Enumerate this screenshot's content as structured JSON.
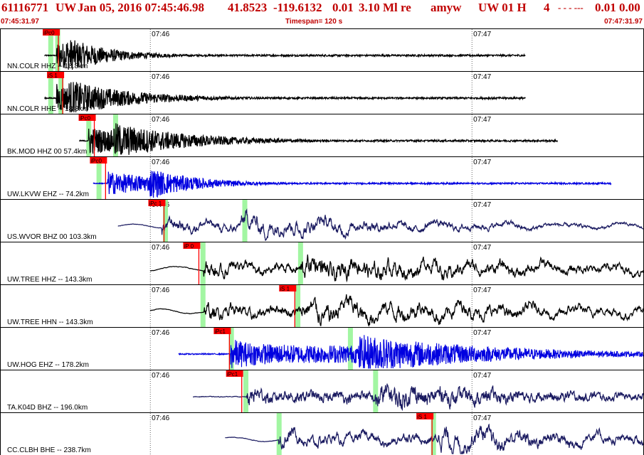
{
  "header": {
    "event_id": "61116771",
    "network": "UW",
    "datetime": "Jan 05, 2016 07:45:46.98",
    "latitude": "41.8523",
    "longitude": "-119.6132",
    "depth": "0.01",
    "magnitude": "3.10 Ml re",
    "author": "amyw",
    "source": "UW 01 H",
    "count": "4",
    "flags": "-  -  - ---",
    "extra": "0.01 0.00"
  },
  "timebar": {
    "start": "07:45:31.97",
    "timespan": "Timespan= 120 s",
    "end": "07:47:31.97"
  },
  "chart_data": {
    "type": "line",
    "title": "",
    "time_start_s": 0,
    "time_end_s": 120,
    "time_ticks": [
      {
        "label": "07:46",
        "t": 28.03
      },
      {
        "label": "07:47",
        "t": 88.03
      }
    ],
    "traces": [
      {
        "label": "NN.COLR HHZ -- 18.8km",
        "color": "#000000",
        "amp": "high",
        "data_start": 8.3,
        "data_end": 98.0,
        "onset": 10.5,
        "s_arrival": 12.4,
        "coda_decay": 8,
        "period": "short",
        "picks": [
          {
            "label": "iPc0",
            "t": 9.3,
            "color": "#ff0000"
          }
        ],
        "green_marks": [
          9.4,
          10.7
        ]
      },
      {
        "label": "NN.COLR HHE -- 18.8km",
        "color": "#000000",
        "amp": "high",
        "data_start": 8.3,
        "data_end": 98.0,
        "onset": 10.5,
        "s_arrival": 12.8,
        "coda_decay": 12,
        "period": "short",
        "picks": [
          {
            "label": "iS 1",
            "t": 10.1,
            "color": "#ff0000"
          }
        ],
        "green_marks": [
          9.4,
          11.3
        ]
      },
      {
        "label": "BK.MOD HHZ 00 57.4km",
        "color": "#000000",
        "amp": "high",
        "data_start": 14.8,
        "data_end": 104.0,
        "onset": 16.5,
        "s_arrival": 21.2,
        "coda_decay": 14,
        "period": "short",
        "picks": [
          {
            "label": "iPc0",
            "t": 16.0,
            "color": "#ff0000"
          }
        ],
        "green_marks": [
          16.5,
          21.5
        ]
      },
      {
        "label": "UW.LKVW EHZ -- 74.2km",
        "color": "#0000e0",
        "amp": "medium",
        "data_start": 17.4,
        "data_end": 114.0,
        "onset": 20.0,
        "s_arrival": 28.0,
        "coda_decay": 9,
        "period": "short",
        "picks": [
          {
            "label": "iPc0",
            "t": 18.1,
            "color": "#ff0000"
          }
        ],
        "green_marks": [
          18.4
        ]
      },
      {
        "label": "US.WVOR BHZ 00 103.3km",
        "color": "#1a1a60",
        "amp": "medium",
        "data_start": 22.0,
        "data_end": 120.0,
        "onset": 30.2,
        "s_arrival": 45.0,
        "coda_decay": 40,
        "period": "long",
        "picks": [
          {
            "label": "iPc 1",
            "t": 29.0,
            "color": "#ff0000"
          }
        ],
        "green_marks": [
          30.8,
          45.6
        ]
      },
      {
        "label": "UW.TREE HHZ -- 143.3km",
        "color": "#000000",
        "amp": "high",
        "data_start": 28.0,
        "data_end": 120.0,
        "onset": 38.0,
        "s_arrival": 56.0,
        "coda_decay": 60,
        "period": "long",
        "picks": [
          {
            "label": "iP 0",
            "t": 35.5,
            "color": "#ff0000"
          }
        ],
        "green_marks": [
          37.8,
          56.0
        ]
      },
      {
        "label": "UW.TREE HHN -- 143.3km",
        "color": "#000000",
        "amp": "high",
        "data_start": 28.0,
        "data_end": 120.0,
        "onset": 38.0,
        "s_arrival": 56.3,
        "coda_decay": 60,
        "period": "long",
        "picks": [
          {
            "label": "iS 1",
            "t": 53.4,
            "color": "#ff0000"
          }
        ],
        "green_marks": [
          37.8,
          55.5
        ]
      },
      {
        "label": "UW.HOG EHZ -- 178.2km",
        "color": "#0000e0",
        "amp": "full",
        "data_start": 33.3,
        "data_end": 120.0,
        "onset": 43.0,
        "s_arrival": 67.0,
        "coda_decay": 25,
        "period": "short",
        "picks": [
          {
            "label": "iPc1",
            "t": 41.2,
            "color": "#ff0000"
          }
        ],
        "green_marks": [
          43.1,
          65.3
        ]
      },
      {
        "label": "TA.K04D BHZ -- 196.0km",
        "color": "#1a1a60",
        "amp": "medium",
        "data_start": 36.0,
        "data_end": 120.0,
        "onset": 46.0,
        "s_arrival": 70.0,
        "coda_decay": 40,
        "period": "mixed",
        "picks": [
          {
            "label": "iPc1",
            "t": 43.5,
            "color": "#ff0000"
          }
        ],
        "green_marks": [
          45.8,
          70.0
        ]
      },
      {
        "label": "CC.CLBH BHE -- 238.7km",
        "color": "#1a1a60",
        "amp": "high",
        "data_start": 42.0,
        "data_end": 120.0,
        "onset": 52.0,
        "s_arrival": 81.8,
        "coda_decay": 40,
        "period": "long",
        "picks": [
          {
            "label": "iS 1",
            "t": 79.0,
            "color": "#ff0000"
          }
        ],
        "green_marks": [
          52.0,
          80.8
        ]
      }
    ]
  }
}
